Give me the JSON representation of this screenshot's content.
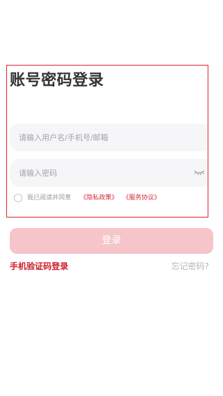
{
  "page": {
    "title": "账号密码登录"
  },
  "form": {
    "account_placeholder": "请输入用户名/手机号/邮箱",
    "account_value": "",
    "password_placeholder": "请输入密码",
    "password_value": "",
    "password_visibility_icon": "eye-closed-icon"
  },
  "agreement": {
    "checked": false,
    "prefix": "我已阅读并同意",
    "privacy_link": "《隐私政策》",
    "service_link": "《服务协议》"
  },
  "actions": {
    "login_label": "登录",
    "sms_login_label": "手机验证码登录",
    "forgot_label": "忘记密码?"
  },
  "colors": {
    "accent": "#cc1f2f",
    "login_button_disabled": "#f5c5c9",
    "input_background": "#f6f6f8",
    "highlight_border": "#e0202c"
  }
}
